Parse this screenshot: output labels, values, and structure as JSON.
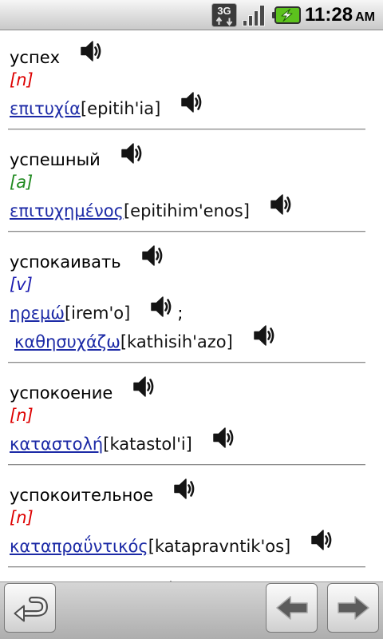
{
  "status_bar": {
    "network_label": "3G",
    "time": "11:28",
    "meridiem": "AM",
    "icons": {
      "network": "network-3g-icon",
      "signal": "signal-strength-icon",
      "battery": "battery-charging-icon"
    }
  },
  "colors": {
    "link": "#1c2aa6"
  },
  "speaker_icon": "speaker-icon",
  "entries": [
    {
      "word": "успех",
      "pos": "[n]",
      "pos_color": "#dd0000",
      "translations": [
        {
          "greek": "επιτυχία",
          "transcription": "[epitih'ia]"
        }
      ]
    },
    {
      "word": "успешный",
      "pos": "[a]",
      "pos_color": "#1f8a1f",
      "translations": [
        {
          "greek": "επιτυχημένος",
          "transcription": "[epitihim'enos]"
        }
      ]
    },
    {
      "word": "успокаивать",
      "pos": "[v]",
      "pos_color": "#1c1cb0",
      "translations": [
        {
          "greek": "ηρεμώ",
          "transcription": "[irem'o]",
          "delimiter": ";"
        },
        {
          "greek": "καθησυχάζω",
          "transcription": "[kathisih'azo]"
        }
      ]
    },
    {
      "word": "успокоение",
      "pos": "[n]",
      "pos_color": "#dd0000",
      "translations": [
        {
          "greek": "καταστολή",
          "transcription": "[katastol'i]"
        }
      ]
    },
    {
      "word": "успокоительное",
      "pos": "[n]",
      "pos_color": "#dd0000",
      "translations": [
        {
          "greek": "καταπραΰντικός",
          "transcription": "[katapravntik'os]"
        }
      ]
    }
  ],
  "toolbar": {
    "back_icon": "back-arrow-icon",
    "previous_icon": "arrow-left-icon",
    "next_icon": "arrow-right-icon"
  }
}
